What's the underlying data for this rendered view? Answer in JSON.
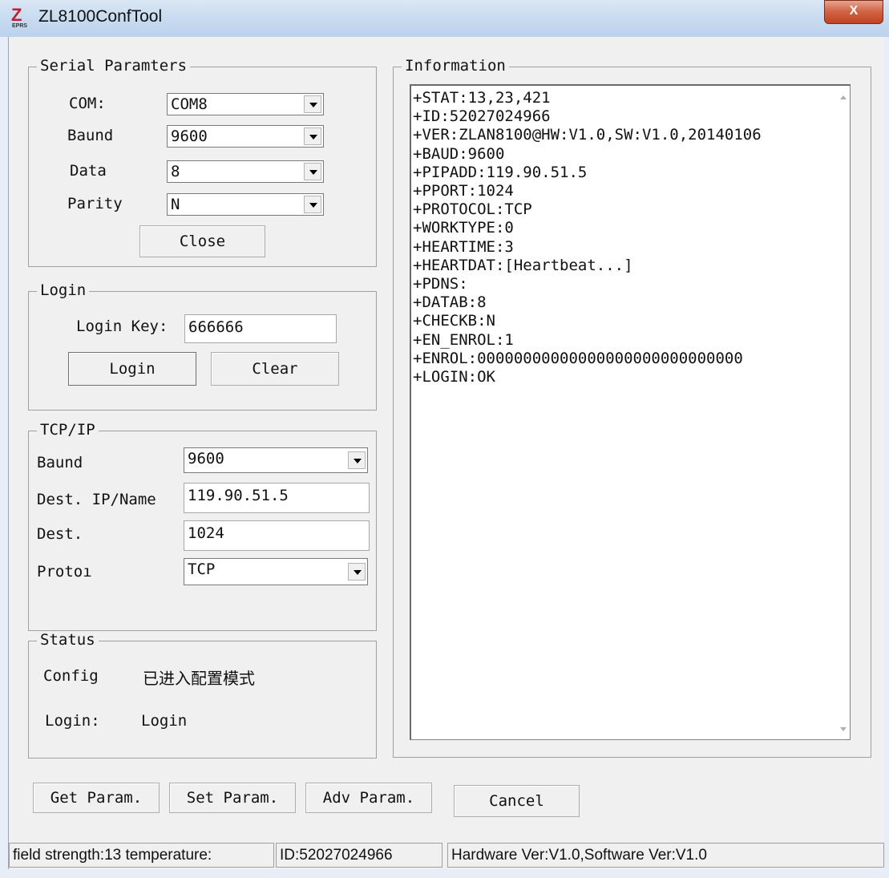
{
  "window": {
    "title": "ZL8100ConfTool",
    "close_label": "X",
    "icon_letter": "Z",
    "icon_sub": "EPRS"
  },
  "serial": {
    "legend": "Serial Paramters",
    "com_label": "COM:",
    "com_value": "COM8",
    "baud_label": "Baund",
    "baud_value": "9600",
    "data_label": "Data",
    "data_value": "8",
    "parity_label": "Parity",
    "parity_value": "N",
    "close_button": "Close"
  },
  "login": {
    "legend": "Login",
    "key_label": "Login Key:",
    "key_value": "666666",
    "login_button": "Login",
    "clear_button": "Clear"
  },
  "tcpip": {
    "legend": "TCP/IP",
    "baud_label": "Baund",
    "baud_value": "9600",
    "dest_ip_label": "Dest. IP/Name",
    "dest_ip_value": "119.90.51.5",
    "dest_port_label": "Dest.",
    "dest_port_value": "1024",
    "proto_label": "Protoı",
    "proto_value": "TCP"
  },
  "status": {
    "legend": "Status",
    "config_label": "Config",
    "config_value": "已进入配置模式",
    "login_label": "Login:",
    "login_value": "Login"
  },
  "information": {
    "legend": "Information",
    "lines": [
      "+STAT:13,23,421",
      "+ID:52027024966",
      "+VER:ZLAN8100@HW:V1.0,SW:V1.0,20140106",
      "+BAUD:9600",
      "+PIPADD:119.90.51.5",
      "+PPORT:1024",
      "+PROTOCOL:TCP",
      "+WORKTYPE:0",
      "+HEARTIME:3",
      "+HEARTDAT:[Heartbeat...]",
      "+PDNS:",
      "+DATAB:8",
      "+CHECKB:N",
      "+EN_ENROL:1",
      "+ENROL:00000000000000000000000000000",
      "+LOGIN:OK"
    ]
  },
  "actions": {
    "get_param": "Get Param.",
    "set_param": "Set Param.",
    "adv_param": "Adv Param.",
    "cancel": "Cancel"
  },
  "statusbar": {
    "field": "field strength:13  temperature:",
    "id": "ID:52027024966",
    "version": "Hardware Ver:V1.0,Software Ver:V1.0"
  }
}
